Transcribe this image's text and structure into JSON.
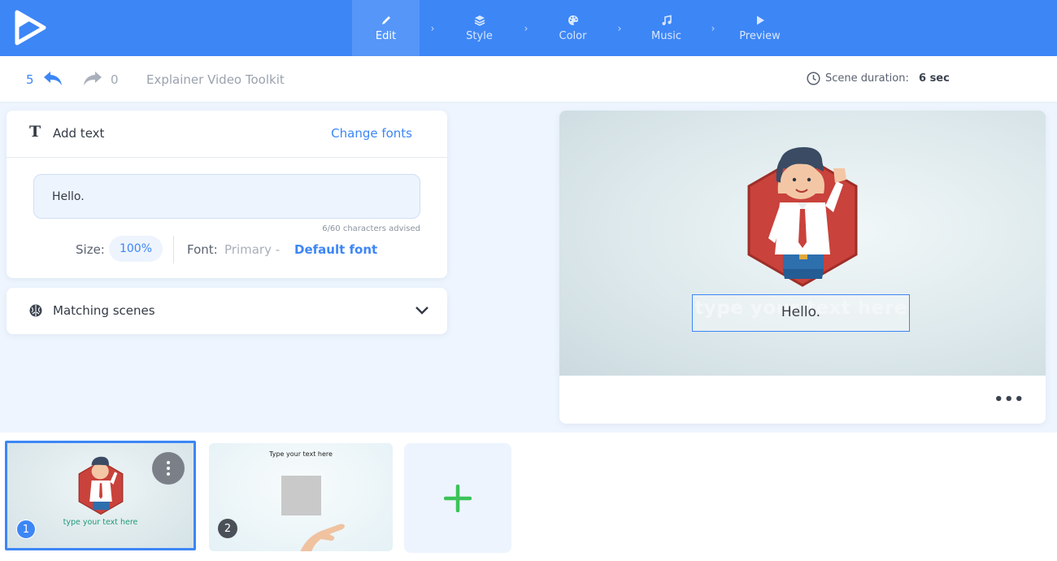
{
  "nav": {
    "steps": [
      {
        "label": "Edit",
        "icon": "pencil-icon"
      },
      {
        "label": "Style",
        "icon": "layers-icon"
      },
      {
        "label": "Color",
        "icon": "palette-icon"
      },
      {
        "label": "Music",
        "icon": "music-note-icon"
      },
      {
        "label": "Preview",
        "icon": "play-icon"
      }
    ],
    "active_step": "Edit"
  },
  "toolbar": {
    "undo_count": "5",
    "redo_count": "0",
    "project_title": "Explainer Video Toolkit",
    "scene_duration_label": "Scene duration:",
    "scene_duration_value": "6 sec"
  },
  "text_panel": {
    "title": "Add text",
    "change_fonts": "Change fonts",
    "input_value": "Hello.",
    "char_hint": "6/60 characters advised",
    "size_label": "Size:",
    "size_value": "100%",
    "font_label": "Font:",
    "font_primary": "Primary -",
    "font_default": "Default font"
  },
  "matching": {
    "label": "Matching scenes"
  },
  "preview": {
    "placeholder_ghost": "type your text here",
    "text": "Hello.",
    "more": "•••"
  },
  "scenes": [
    {
      "number": "1",
      "text": "type your text here",
      "selected": true
    },
    {
      "number": "2",
      "text": "Type your text here",
      "selected": false
    }
  ],
  "colors": {
    "accent": "#3d86f6",
    "hexagon": "#c9423b",
    "add_green": "#3cc35a"
  }
}
